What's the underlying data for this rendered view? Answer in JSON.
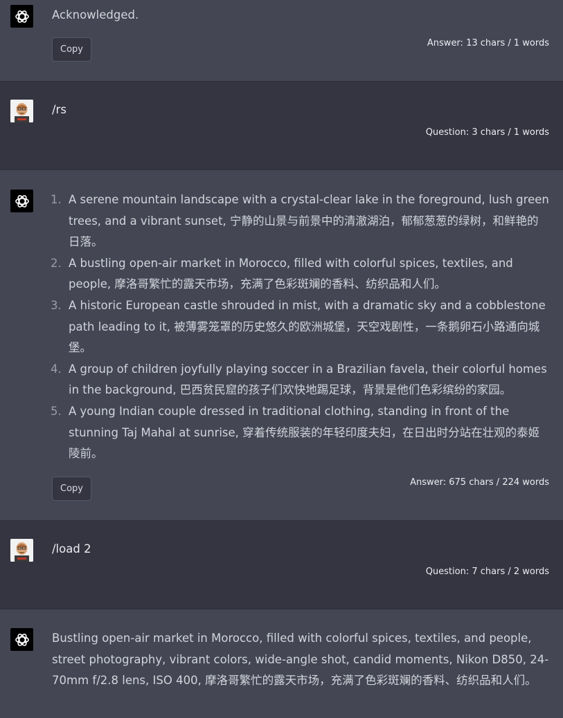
{
  "messages": {
    "m1": {
      "text": "Acknowledged.",
      "copy_label": "Copy",
      "stats": "Answer: 13 chars / 1 words"
    },
    "m2": {
      "text": "/rs",
      "stats": "Question: 3 chars / 1 words"
    },
    "m3": {
      "items": [
        {
          "num": "1.",
          "text": "A serene mountain landscape with a crystal-clear lake in the foreground, lush green trees, and a vibrant sunset, 宁静的山景与前景中的清澈湖泊，郁郁葱葱的绿树，和鲜艳的日落。"
        },
        {
          "num": "2.",
          "text": "A bustling open-air market in Morocco, filled with colorful spices, textiles, and people, 摩洛哥繁忙的露天市场，充满了色彩斑斓的香料、纺织品和人们。"
        },
        {
          "num": "3.",
          "text": "A historic European castle shrouded in mist, with a dramatic sky and a cobblestone path leading to it, 被薄雾笼罩的历史悠久的欧洲城堡，天空戏剧性，一条鹅卵石小路通向城堡。"
        },
        {
          "num": "4.",
          "text": "A group of children joyfully playing soccer in a Brazilian favela, their colorful homes in the background, 巴西贫民窟的孩子们欢快地踢足球，背景是他们色彩缤纷的家园。"
        },
        {
          "num": "5.",
          "text": "A young Indian couple dressed in traditional clothing, standing in front of the stunning Taj Mahal at sunrise, 穿着传统服装的年轻印度夫妇，在日出时分站在壮观的泰姬陵前。"
        }
      ],
      "copy_label": "Copy",
      "stats": "Answer: 675 chars / 224 words"
    },
    "m4": {
      "text": "/load 2",
      "stats": "Question: 7 chars / 2 words"
    },
    "m5": {
      "text": "Bustling open-air market in Morocco, filled with colorful spices, textiles, and people, street photography, vibrant colors, wide-angle shot, candid moments, Nikon D850, 24-70mm f/2.8 lens, ISO 400, 摩洛哥繁忙的露天市场，充满了色彩斑斓的香料、纺织品和人们。"
    }
  },
  "icons": {
    "assistant": "openai-logo-icon",
    "user": "user-avatar"
  },
  "colors": {
    "assistant_bg": "#444654",
    "user_bg": "#343541",
    "text": "#d1d5db"
  }
}
